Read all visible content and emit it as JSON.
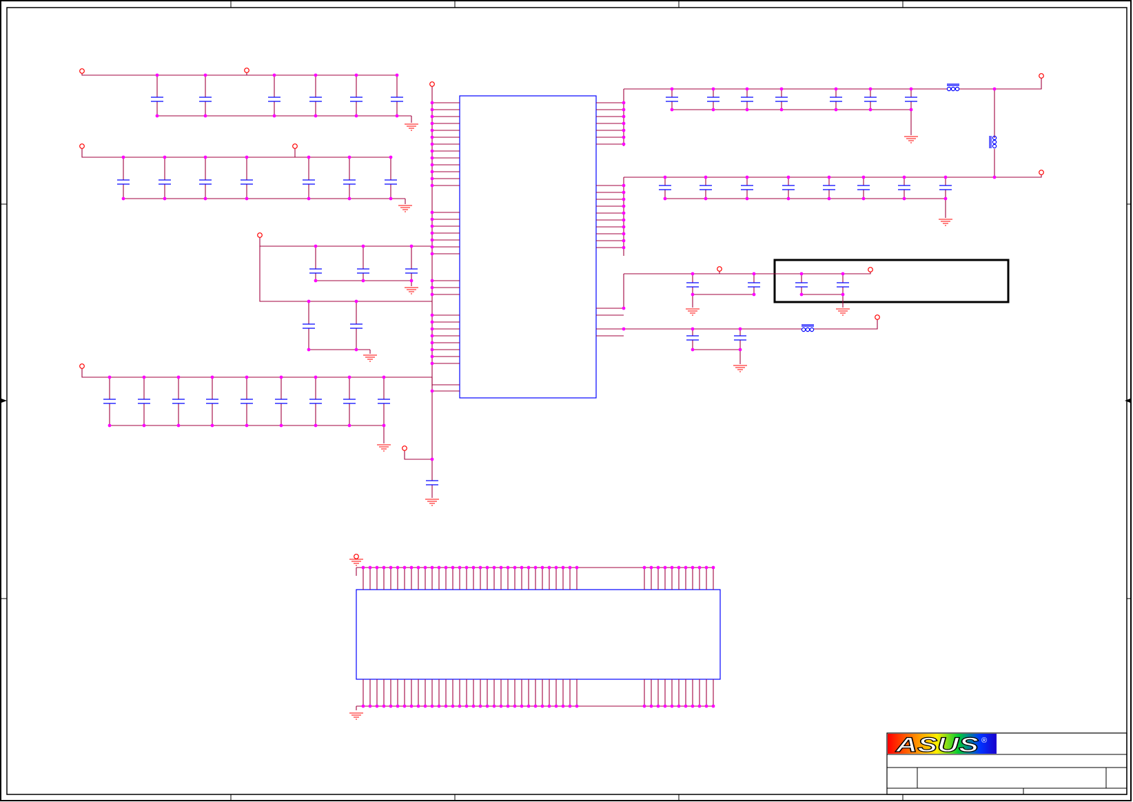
{
  "colors": {
    "wire": "#a0003c",
    "junction": "#ff00ff",
    "component": "#0000ff",
    "power": "#ff0000",
    "ground": "#ff0000",
    "frame": "#000000"
  },
  "title_block": {
    "logo_text": "ASUS",
    "registered_mark": "®"
  },
  "icons": {
    "power_port": "open-circle-icon",
    "ground": "ground-icon",
    "capacitor": "capacitor-icon",
    "inductor": "inductor-coil-icon"
  }
}
